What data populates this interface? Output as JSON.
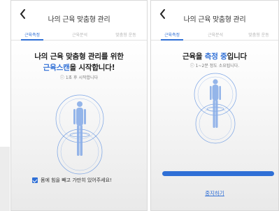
{
  "screen1": {
    "title": "나의 근육 맞춤형 관리",
    "tabs": [
      {
        "label": "근육측정",
        "active": true
      },
      {
        "label": "근육분석",
        "active": false
      },
      {
        "label": "맞춤형 운동",
        "active": false
      }
    ],
    "headline_line1": "나의 근육 맞춤형 관리를 위한",
    "headline_line2_highlight": "근육스캔",
    "headline_line2_rest": "을 시작합니다!",
    "countdown_note": "ⓘ 1초 후 시작합니다",
    "checkbox_label": "몸에 힘을 빼고 가만히 있어주세요!",
    "checkbox_checked": true
  },
  "screen2": {
    "title": "나의 근육 맞춤형 관리",
    "tabs": [
      {
        "label": "근육측정",
        "active": true
      },
      {
        "label": "근육분석",
        "active": false
      },
      {
        "label": "맞춤형 운동",
        "active": false
      }
    ],
    "headline_prefix": "근육을 ",
    "headline_highlight": "측정 중",
    "headline_suffix": "입니다",
    "duration_note": "ⓘ 1~2분 정도 소요됩니다.",
    "progress_value": 1.0,
    "stop_label": "중지하기"
  },
  "colors": {
    "accent": "#2f6fd6",
    "tab_inactive": "#b5b5b5",
    "background_gradient_end": "#e9e9e9"
  },
  "icons": {
    "back": "chevron-left-icon",
    "body_scan": "body-scan-figure-icon",
    "info": "info-circle-icon",
    "check": "checkbox-checked-icon"
  }
}
